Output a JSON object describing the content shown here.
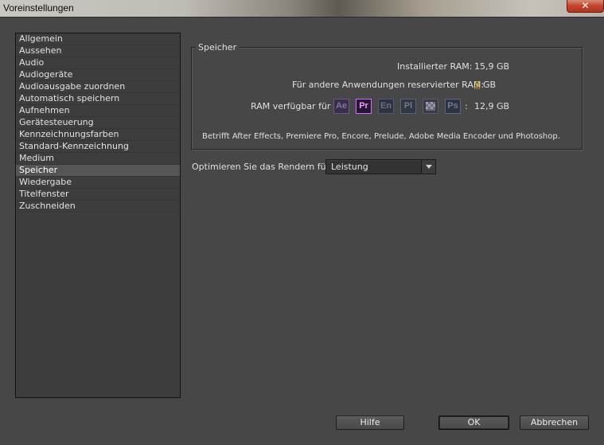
{
  "window": {
    "title": "Voreinstellungen",
    "close_label": "✕"
  },
  "sidebar": {
    "items": [
      {
        "label": "Allgemein",
        "selected": false
      },
      {
        "label": "Aussehen",
        "selected": false
      },
      {
        "label": "Audio",
        "selected": false
      },
      {
        "label": "Audiogeräte",
        "selected": false
      },
      {
        "label": "Audioausgabe zuordnen",
        "selected": false
      },
      {
        "label": "Automatisch speichern",
        "selected": false
      },
      {
        "label": "Aufnehmen",
        "selected": false
      },
      {
        "label": "Gerätesteuerung",
        "selected": false
      },
      {
        "label": "Kennzeichnungsfarben",
        "selected": false
      },
      {
        "label": "Standard-Kennzeichnung",
        "selected": false
      },
      {
        "label": "Medium",
        "selected": false
      },
      {
        "label": "Speicher",
        "selected": true
      },
      {
        "label": "Wiedergabe",
        "selected": false
      },
      {
        "label": "Titelfenster",
        "selected": false
      },
      {
        "label": "Zuschneiden",
        "selected": false
      }
    ]
  },
  "memory": {
    "group_label": "Speicher",
    "installed_label": "Installierter RAM:",
    "installed_value": "15,9 GB",
    "reserved_label": "Für andere Anwendungen reservierter RAM:",
    "reserved_value": "3",
    "reserved_unit": "GB",
    "available_label": "RAM verfügbar für",
    "available_colon": ":",
    "available_value": "12,9 GB",
    "apps": [
      {
        "icon": "after-effects-icon",
        "abbr": "Ae"
      },
      {
        "icon": "premiere-pro-icon",
        "abbr": "Pr",
        "active": true
      },
      {
        "icon": "encore-icon",
        "abbr": "En"
      },
      {
        "icon": "prelude-icon",
        "abbr": "Pl"
      },
      {
        "icon": "media-encoder-icon",
        "abbr": ""
      },
      {
        "icon": "photoshop-icon",
        "abbr": "Ps"
      }
    ],
    "note": "Betrifft After Effects, Premiere Pro, Encore, Prelude, Adobe Media Encoder und Photoshop."
  },
  "render": {
    "label": "Optimieren Sie das Rendern für:",
    "selected_option": "Leistung"
  },
  "buttons": {
    "help": "Hilfe",
    "ok": "OK",
    "cancel": "Abbrechen"
  },
  "colors": {
    "background": "#474747",
    "accent_input": "#f0a020",
    "premiere_highlight": "#d46dff"
  }
}
